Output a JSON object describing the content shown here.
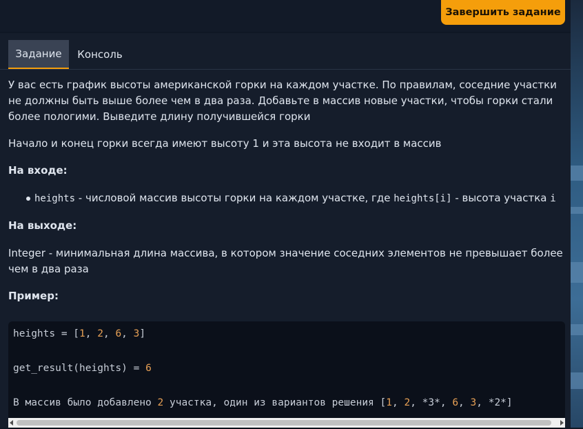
{
  "header": {
    "finish_label": "Завершить задание"
  },
  "tabs": [
    {
      "label": "Задание"
    },
    {
      "label": "Консоль"
    }
  ],
  "task": {
    "intro": "У вас есть график высоты американской горки на каждом участке. По правилам, соседние участки не должны быть выше более чем в два раза. Добавьте в массив новые участки, чтобы горки стали более пологими. Выведите длину получившейся горки",
    "note": "Начало и конец горки всегда имеют высоту 1 и эта высота не входит в массив",
    "input_heading": "На входе:",
    "input_item": {
      "code1": "heights",
      "text1": " - числовой массив высоты горки на каждом участке, где ",
      "code2": "heights[i]",
      "text2": " - высота участка ",
      "code3": "i"
    },
    "output_heading": "На выходе:",
    "output_text": "Integer - минимальная длина массива, в котором значение соседних элементов не превышает более чем в два раза",
    "example_heading": "Пример:"
  },
  "code": {
    "line1": {
      "a": "heights = [",
      "n1": "1",
      "s1": ", ",
      "n2": "2",
      "s2": ", ",
      "n3": "6",
      "s3": ", ",
      "n4": "3",
      "b": "]"
    },
    "line2": {
      "a": "get_result(heights) = ",
      "n1": "6"
    },
    "line3": {
      "a": "В массив было добавлено ",
      "n1": "2",
      "b": " участка, один из вариантов решения [",
      "n2": "1",
      "s1": ", ",
      "n3": "2",
      "c": ", *3*, ",
      "n4": "6",
      "s2": ", ",
      "n5": "3",
      "d": ", *2*]"
    }
  },
  "colors": {
    "accent": "#f59e0b",
    "number": "#e7a055",
    "background": "#151d2b"
  }
}
